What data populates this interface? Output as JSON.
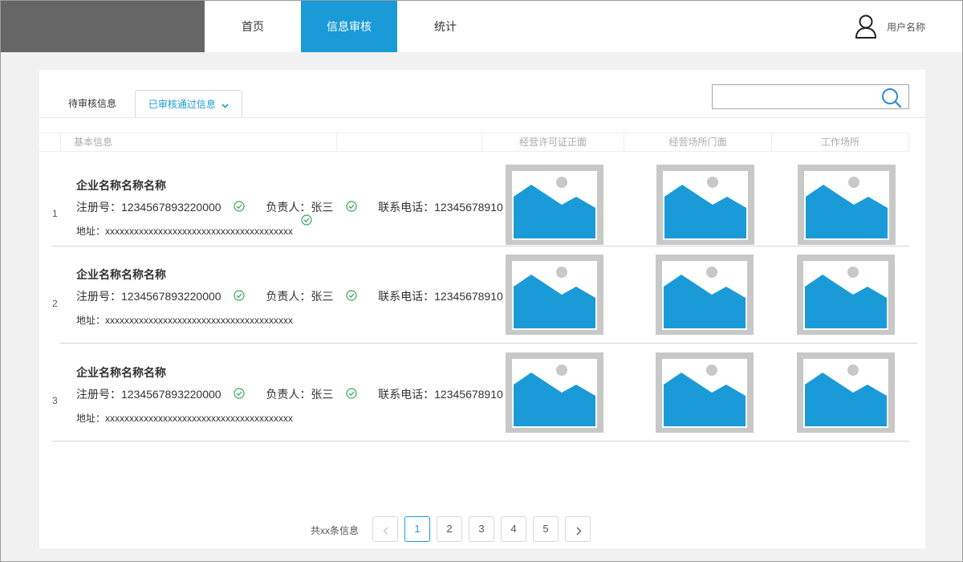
{
  "nav": {
    "items": [
      {
        "label": "首页"
      },
      {
        "label": "信息审核"
      },
      {
        "label": "统计"
      }
    ],
    "active_index": 1,
    "user_name": "用户名称"
  },
  "tabs": {
    "pending": "待审核信息",
    "approved": "已审核通过信息"
  },
  "search": {
    "placeholder": ""
  },
  "table": {
    "headers": [
      "基本信息",
      "",
      "经营许可证正面",
      "经营场所门面",
      "工作场所"
    ]
  },
  "rows": [
    {
      "index": "1",
      "company": "企业名称名称名称",
      "reg_label": "注册号：",
      "reg_value": "1234567893220000",
      "person_label": "负责人：",
      "person_value": "张三",
      "phone_label": "联系电话：",
      "phone_value": "12345678910",
      "address_label": "地址：",
      "address_value": "xxxxxxxxxxxxxxxxxxxxxxxxxxxxxxxxxxxxxxx"
    },
    {
      "index": "2",
      "company": "企业名称名称名称",
      "reg_label": "注册号：",
      "reg_value": "1234567893220000",
      "person_label": "负责人：",
      "person_value": "张三",
      "phone_label": "联系电话：",
      "phone_value": "12345678910",
      "address_label": "地址：",
      "address_value": "xxxxxxxxxxxxxxxxxxxxxxxxxxxxxxxxxxxxxxx"
    },
    {
      "index": "3",
      "company": "企业名称名称名称",
      "reg_label": "注册号：",
      "reg_value": "1234567893220000",
      "person_label": "负责人：",
      "person_value": "张三",
      "phone_label": "联系电话：",
      "phone_value": "12345678910",
      "address_label": "地址：",
      "address_value": "xxxxxxxxxxxxxxxxxxxxxxxxxxxxxxxxxxxxxxx"
    }
  ],
  "pagination": {
    "total_text": "共xx条信息",
    "prev_icon": "chevron-left-icon",
    "next_icon": "chevron-right-icon",
    "pages": [
      "1",
      "2",
      "3",
      "4",
      "5"
    ],
    "current": "1"
  },
  "colors": {
    "accent": "#1a9bd8",
    "logo_bg": "#666666",
    "check_green": "#3aa55c",
    "image_frame": "#c8c8c8"
  }
}
